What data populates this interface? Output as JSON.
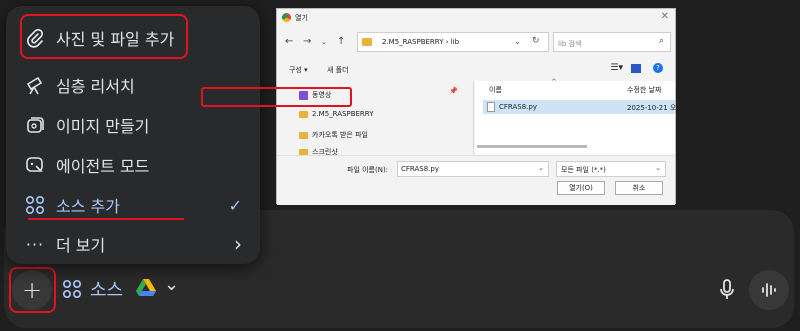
{
  "menu": {
    "items": [
      {
        "id": "photo",
        "label": "사진 및 파일 추가",
        "icon": "paperclip-icon"
      },
      {
        "id": "research",
        "label": "심층 리서치",
        "icon": "telescope-icon"
      },
      {
        "id": "image",
        "label": "이미지 만들기",
        "icon": "image-icon"
      },
      {
        "id": "agent",
        "label": "에이전트 모드",
        "icon": "agent-icon"
      },
      {
        "id": "source",
        "label": "소스 추가",
        "icon": "sources-icon",
        "trailing": "✓"
      },
      {
        "id": "more",
        "label": "더 보기",
        "icon": "more-icon",
        "trailing": "›"
      }
    ]
  },
  "composer": {
    "plus": "+",
    "source_chip": "소스",
    "chevron": "⌄",
    "accent": "#a8c7fa"
  },
  "dialog": {
    "title": "열기",
    "path": "2.M5_RASPBERRY  ›  lib",
    "search_placeholder": "lib 검색",
    "organize": "구성 ▾",
    "new_folder": "새 폴더",
    "tree": [
      {
        "label": "동영상",
        "kind": "video"
      },
      {
        "label": "2.M5_RASPBERRY",
        "kind": "folder"
      },
      {
        "label": "카카오톡 받은 파일",
        "kind": "folder"
      },
      {
        "label": "스크린샷",
        "kind": "folder"
      }
    ],
    "columns": {
      "name": "이름",
      "date": "수정한 날짜"
    },
    "file": {
      "name": "CFRAS8.py",
      "date": "2025-10-21 오"
    },
    "filename_label": "파일 이름(N):",
    "filename_value": "CFRAS8.py",
    "filetype": "모든 파일 (*.*)",
    "open": "열기(O)",
    "cancel": "취소"
  },
  "colors": {
    "highlight": "#e0141e",
    "accent": "#a8c7fa"
  }
}
